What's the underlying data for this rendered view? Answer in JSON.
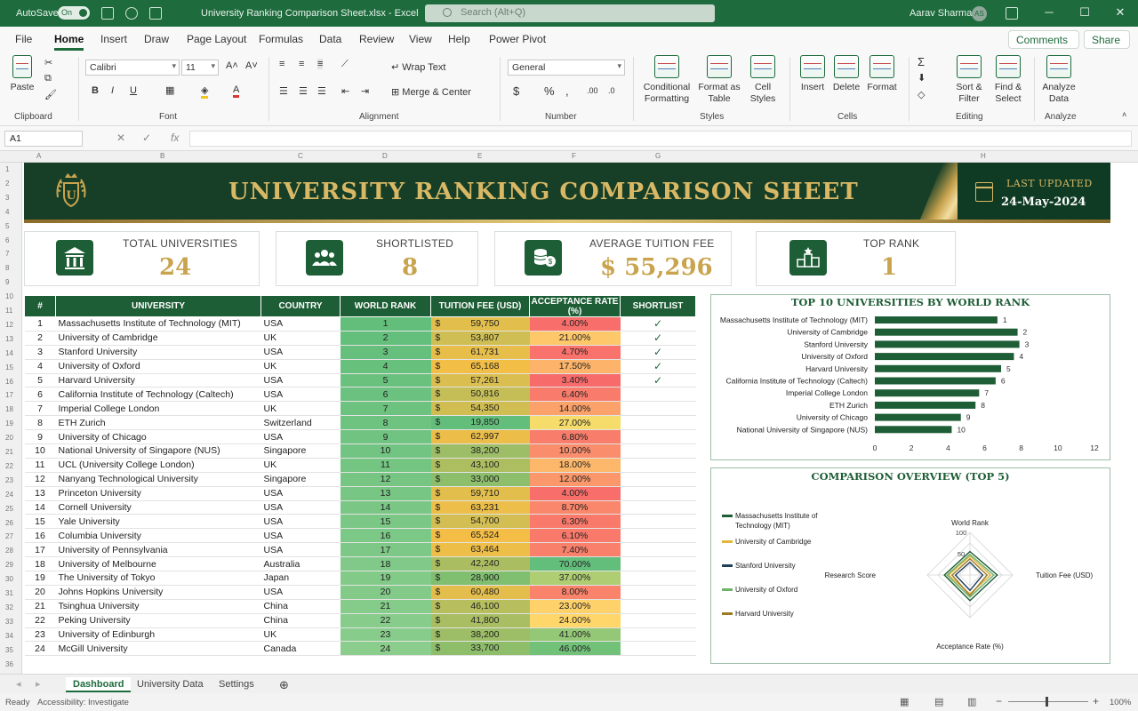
{
  "window": {
    "autosave_label": "AutoSave",
    "autosave_state": "On",
    "doc_title": "University Ranking Comparison Sheet.xlsx  -  Excel",
    "search_placeholder": "Search (Alt+Q)",
    "user_name": "Aarav Sharma",
    "user_initials": "AS"
  },
  "ribbon": {
    "tabs": [
      "File",
      "Home",
      "Insert",
      "Draw",
      "Page Layout",
      "Formulas",
      "Data",
      "Review",
      "View",
      "Help",
      "Power Pivot"
    ],
    "comments_label": "Comments",
    "share_label": "Share",
    "paste_label": "Paste",
    "font_name": "Calibri",
    "font_size": "11",
    "wrap_text_label": "Wrap Text",
    "merge_center_label": "Merge & Center",
    "number_format": "General",
    "conditional_formatting_label": "Conditional Formatting",
    "format_as_table_label": "Format as Table",
    "cell_styles_label": "Cell Styles",
    "insert_label": "Insert",
    "delete_label": "Delete",
    "format_label": "Format",
    "sort_filter_label": "Sort & Filter",
    "find_select_label": "Find & Select",
    "analyze_data_label": "Analyze Data",
    "groups": [
      "Clipboard",
      "Font",
      "Alignment",
      "Number",
      "Styles",
      "Cells",
      "Editing",
      "Analyze"
    ]
  },
  "formula_bar": {
    "name_box": "A1",
    "fx_label": "fx",
    "value": ""
  },
  "banner": {
    "title": "UNIVERSITY RANKING COMPARISON SHEET",
    "last_updated_label": "LAST UPDATED",
    "last_updated_date": "24-May-2024"
  },
  "kpis": [
    {
      "label": "TOTAL UNIVERSITIES",
      "value": "24",
      "icon": "institution-icon"
    },
    {
      "label": "SHORTLISTED",
      "value": "8",
      "icon": "group-users-icon"
    },
    {
      "label": "AVERAGE TUITION FEE",
      "value": "$ 55,296",
      "icon": "coins-icon"
    },
    {
      "label": "TOP RANK",
      "value": "1",
      "icon": "podium-icon"
    }
  ],
  "table": {
    "headers": [
      "#",
      "UNIVERSITY",
      "COUNTRY",
      "WORLD RANK",
      "TUITION FEE (USD)",
      "ACCEPTANCE RATE (%)",
      "SHORTLIST"
    ],
    "rows": [
      {
        "n": "1",
        "name": "Massachusetts Institute of Technology (MIT)",
        "country": "USA",
        "rank": "1",
        "fee": "59,750",
        "acc": "4.00%",
        "short": true
      },
      {
        "n": "2",
        "name": "University of Cambridge",
        "country": "UK",
        "rank": "2",
        "fee": "53,807",
        "acc": "21.00%",
        "short": true
      },
      {
        "n": "3",
        "name": "Stanford University",
        "country": "USA",
        "rank": "3",
        "fee": "61,731",
        "acc": "4.70%",
        "short": true
      },
      {
        "n": "4",
        "name": "University of Oxford",
        "country": "UK",
        "rank": "4",
        "fee": "65,168",
        "acc": "17.50%",
        "short": true
      },
      {
        "n": "5",
        "name": "Harvard University",
        "country": "USA",
        "rank": "5",
        "fee": "57,261",
        "acc": "3.40%",
        "short": true
      },
      {
        "n": "6",
        "name": "California Institute of Technology (Caltech)",
        "country": "USA",
        "rank": "6",
        "fee": "50,816",
        "acc": "6.40%",
        "short": false
      },
      {
        "n": "7",
        "name": "Imperial College London",
        "country": "UK",
        "rank": "7",
        "fee": "54,350",
        "acc": "14.00%",
        "short": false
      },
      {
        "n": "8",
        "name": "ETH Zurich",
        "country": "Switzerland",
        "rank": "8",
        "fee": "19,850",
        "acc": "27.00%",
        "short": false
      },
      {
        "n": "9",
        "name": "University of Chicago",
        "country": "USA",
        "rank": "9",
        "fee": "62,997",
        "acc": "6.80%",
        "short": false
      },
      {
        "n": "10",
        "name": "National University of Singapore (NUS)",
        "country": "Singapore",
        "rank": "10",
        "fee": "38,200",
        "acc": "10.00%",
        "short": false
      },
      {
        "n": "11",
        "name": "UCL (University College London)",
        "country": "UK",
        "rank": "11",
        "fee": "43,100",
        "acc": "18.00%",
        "short": false
      },
      {
        "n": "12",
        "name": "Nanyang Technological University",
        "country": "Singapore",
        "rank": "12",
        "fee": "33,000",
        "acc": "12.00%",
        "short": false
      },
      {
        "n": "13",
        "name": "Princeton University",
        "country": "USA",
        "rank": "13",
        "fee": "59,710",
        "acc": "4.00%",
        "short": false
      },
      {
        "n": "14",
        "name": "Cornell University",
        "country": "USA",
        "rank": "14",
        "fee": "63,231",
        "acc": "8.70%",
        "short": false
      },
      {
        "n": "15",
        "name": "Yale University",
        "country": "USA",
        "rank": "15",
        "fee": "54,700",
        "acc": "6.30%",
        "short": false
      },
      {
        "n": "16",
        "name": "Columbia University",
        "country": "USA",
        "rank": "16",
        "fee": "65,524",
        "acc": "6.10%",
        "short": false
      },
      {
        "n": "17",
        "name": "University of Pennsylvania",
        "country": "USA",
        "rank": "17",
        "fee": "63,464",
        "acc": "7.40%",
        "short": false
      },
      {
        "n": "18",
        "name": "University of Melbourne",
        "country": "Australia",
        "rank": "18",
        "fee": "42,240",
        "acc": "70.00%",
        "short": false
      },
      {
        "n": "19",
        "name": "The University of Tokyo",
        "country": "Japan",
        "rank": "19",
        "fee": "28,900",
        "acc": "37.00%",
        "short": false
      },
      {
        "n": "20",
        "name": "Johns Hopkins University",
        "country": "USA",
        "rank": "20",
        "fee": "60,480",
        "acc": "8.00%",
        "short": false
      },
      {
        "n": "21",
        "name": "Tsinghua University",
        "country": "China",
        "rank": "21",
        "fee": "46,100",
        "acc": "23.00%",
        "short": false
      },
      {
        "n": "22",
        "name": "Peking University",
        "country": "China",
        "rank": "22",
        "fee": "41,800",
        "acc": "24.00%",
        "short": false
      },
      {
        "n": "23",
        "name": "University of Edinburgh",
        "country": "UK",
        "rank": "23",
        "fee": "38,200",
        "acc": "41.00%",
        "short": false
      },
      {
        "n": "24",
        "name": "McGill University",
        "country": "Canada",
        "rank": "24",
        "fee": "33,700",
        "acc": "46.00%",
        "short": false
      }
    ]
  },
  "chart_data": [
    {
      "type": "bar",
      "orientation": "horizontal",
      "title": "TOP 10 UNIVERSITIES BY WORLD RANK",
      "categories": [
        "Massachusetts Institute of Technology (MIT)",
        "University of Cambridge",
        "Stanford University",
        "University of Oxford",
        "Harvard University",
        "California Institute of Technology (Caltech)",
        "Imperial College London",
        "ETH Zurich",
        "University of Chicago",
        "National University of Singapore (NUS)"
      ],
      "values": [
        6.7,
        7.8,
        7.9,
        7.6,
        6.9,
        6.6,
        5.7,
        5.5,
        4.7,
        4.2
      ],
      "data_labels": [
        "1",
        "2",
        "3",
        "4",
        "5",
        "6",
        "7",
        "8",
        "9",
        "10"
      ],
      "xticks": [
        "0",
        "2",
        "4",
        "6",
        "8",
        "10",
        "12"
      ],
      "xlim": [
        0,
        12
      ],
      "color": "#1e5e36"
    },
    {
      "type": "radar",
      "title": "COMPARISON OVERVIEW (TOP 5)",
      "axes": [
        "World Rank",
        "Tuition Fee (USD)",
        "Acceptance Rate (%)",
        "Research Score"
      ],
      "rticks": [
        "50",
        "100"
      ],
      "rlim": [
        0,
        100
      ],
      "legend_position": "left",
      "series": [
        {
          "name": "Massachusetts Institute of Technology (MIT)",
          "color": "#1e5e36",
          "values": [
            55,
            64,
            60,
            60
          ]
        },
        {
          "name": "University of Cambridge",
          "color": "#e3b53a",
          "values": [
            44,
            48,
            44,
            50
          ]
        },
        {
          "name": "Stanford University",
          "color": "#1f3f5a",
          "values": [
            30,
            30,
            36,
            34
          ]
        },
        {
          "name": "University of Oxford",
          "color": "#6db36a",
          "values": [
            48,
            56,
            52,
            54
          ]
        },
        {
          "name": "Harvard University",
          "color": "#9c7a22",
          "values": [
            38,
            40,
            48,
            42
          ]
        }
      ]
    }
  ],
  "sheet_tabs": [
    "Dashboard",
    "University Data",
    "Settings"
  ],
  "status": {
    "ready": "Ready",
    "accessibility": "Accessibility: Investigate",
    "zoom": "100%"
  }
}
